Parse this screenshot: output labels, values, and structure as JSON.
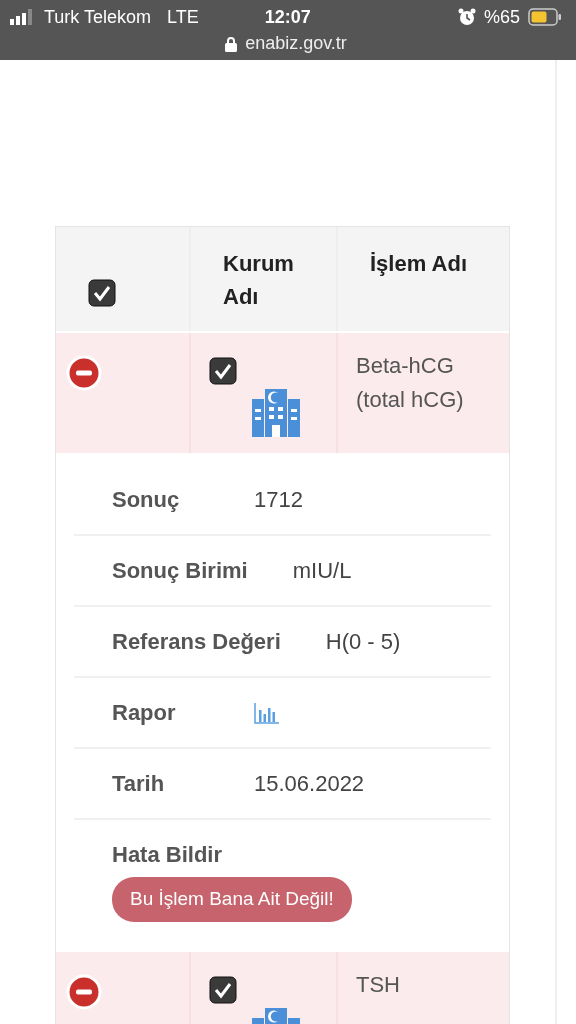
{
  "status_bar": {
    "carrier": "Turk Telekom",
    "network": "LTE",
    "time": "12:07",
    "battery": "%65"
  },
  "address_bar": {
    "url": "enabiz.gov.tr"
  },
  "table": {
    "columns": [
      {
        "kind": "checkbox",
        "checked": true
      },
      {
        "kind": "text",
        "label": "Kurum Adı"
      },
      {
        "kind": "text",
        "label": "İşlem Adı"
      }
    ],
    "rows": [
      {
        "expanded": true,
        "checked": true,
        "procedure": "Beta-hCG (total hCG)",
        "details": [
          {
            "kind": "text",
            "label": "Sonuç",
            "value": "1712"
          },
          {
            "kind": "text",
            "label": "Sonuç Birimi",
            "value": "mIU/L"
          },
          {
            "kind": "text",
            "label": "Referans Değeri",
            "value": "H(0 - 5)"
          },
          {
            "kind": "report",
            "label": "Rapor"
          },
          {
            "kind": "text",
            "label": "Tarih",
            "value": "15.06.2022"
          },
          {
            "kind": "action",
            "label": "Hata Bildir",
            "button": "Bu İşlem Bana Ait Değil!"
          }
        ]
      },
      {
        "expanded": true,
        "checked": true,
        "procedure": "TSH"
      }
    ]
  }
}
